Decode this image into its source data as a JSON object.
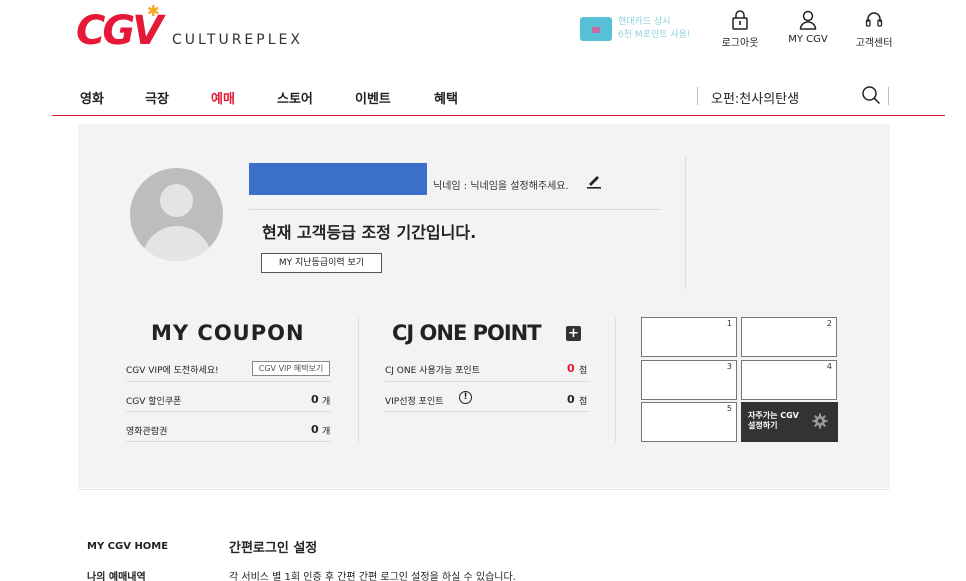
{
  "header": {
    "logo_text": "CGV",
    "logo_sub": "CULTUREPLEX",
    "promo_line1": "현대카드 상시",
    "promo_line2": "6천 M포인트 사용!",
    "nav": [
      {
        "label": "로그아웃",
        "icon": "lock-icon"
      },
      {
        "label": "MY CGV",
        "icon": "user-icon"
      },
      {
        "label": "고객센터",
        "icon": "headset-icon"
      }
    ]
  },
  "gnb": {
    "items": [
      "영화",
      "극장",
      "예매",
      "스토어",
      "이벤트",
      "혜택"
    ],
    "active_index": 2,
    "search_text": "오펀:천사의탄생"
  },
  "profile": {
    "nickname_text": "닉네임 : 닉네임을 설정해주세요.",
    "grade_text": "현재 고객등급 조정 기간입니다.",
    "history_button": "MY 지난등급이력 보기"
  },
  "coupon": {
    "title": "MY COUPON",
    "vip_label": "CGV VIP에 도전하세요!",
    "vip_button": "CGV VIP 혜택보기",
    "rows": [
      {
        "label": "CGV 할인쿠폰",
        "value": "0",
        "unit": "개"
      },
      {
        "label": "영화관람권",
        "value": "0",
        "unit": "개"
      }
    ]
  },
  "cjone": {
    "title": "CJ ONE POINT",
    "plus_label": "+",
    "rows": [
      {
        "label": "CJ ONE 사용가능 포인트",
        "value": "0",
        "unit": "점"
      },
      {
        "label": "VIP선정 포인트",
        "value": "0",
        "unit": "점"
      }
    ]
  },
  "favorites": {
    "slots": [
      "1",
      "2",
      "3",
      "4",
      "5"
    ],
    "setting_line1": "자주가는 CGV",
    "setting_line2": "설정하기"
  },
  "sidebar": {
    "items": [
      "MY CGV HOME",
      "나의 예매내역"
    ]
  },
  "section": {
    "title": "간편로그인 설정",
    "desc": "각 서비스 별 1회 인증 후 간편 간편 로그인 설정을 하실 수 있습니다."
  },
  "colors": {
    "brand_red": "#e51937",
    "name_box": "#3b6fc8"
  }
}
